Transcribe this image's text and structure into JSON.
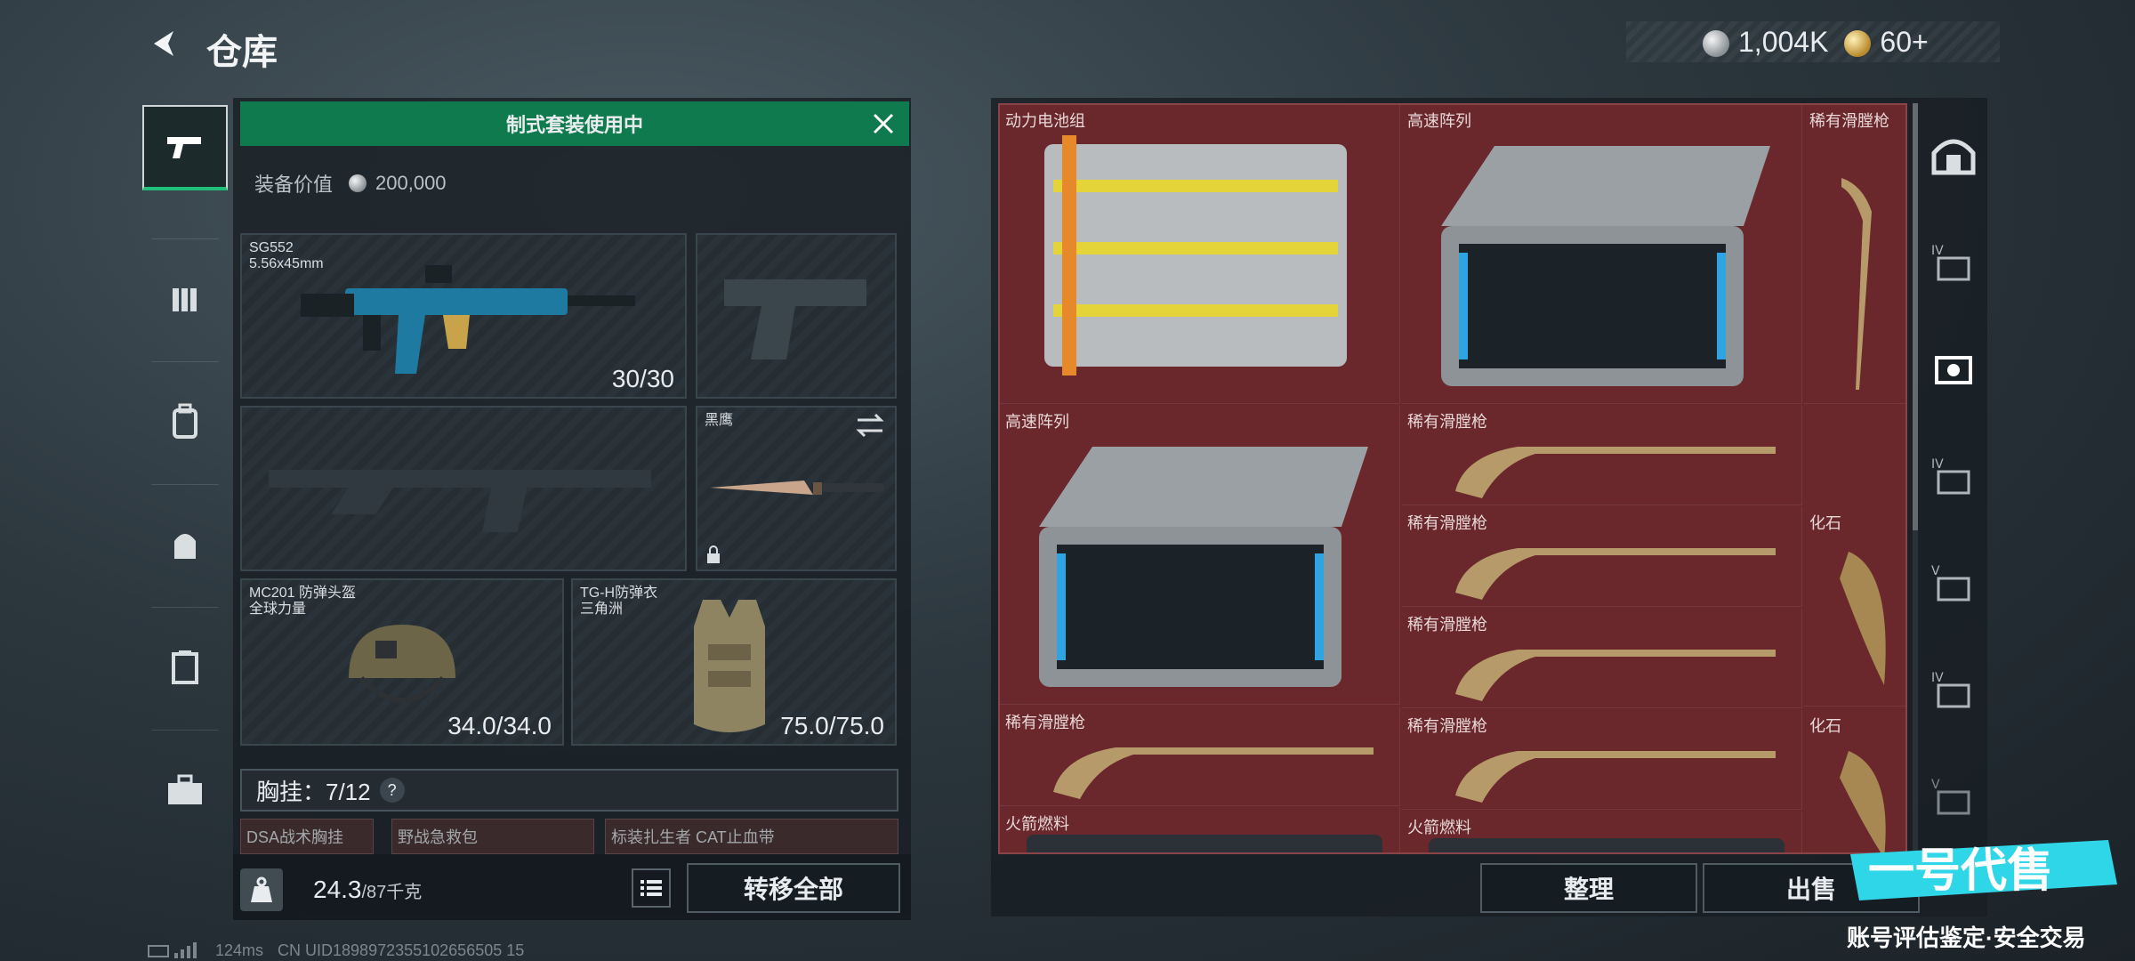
{
  "header": {
    "title": "仓库"
  },
  "currency": {
    "coins": "1,004K",
    "gold": "60+"
  },
  "banner": {
    "text": "制式套装使用中"
  },
  "loadout": {
    "value_label": "装备价值",
    "value": "200,000",
    "primary": {
      "name": "SG552",
      "caliber": "5.56x45mm",
      "ammo": "30/30"
    },
    "melee": {
      "name": "黑鹰"
    },
    "helmet": {
      "name": "MC201 防弹头盔",
      "brand": "全球力量",
      "durability": "34.0/34.0"
    },
    "armor": {
      "name": "TG-H防弹衣",
      "brand": "三角洲",
      "durability": "75.0/75.0"
    },
    "chest": {
      "label": "胸挂：7/12",
      "help": "?"
    },
    "subslots": [
      "DSA战术胸挂",
      "野战急救包",
      "标装扎生者 CAT止血带"
    ],
    "weight": {
      "current": "24.3",
      "max": "/87千克"
    },
    "transfer_label": "转移全部"
  },
  "storage": {
    "items": [
      {
        "label": "动力电池组"
      },
      {
        "label": "高速阵列"
      },
      {
        "label": "稀有滑膛枪"
      },
      {
        "label": "高速阵列"
      },
      {
        "label": "稀有滑膛枪"
      },
      {
        "label": "稀有滑膛枪"
      },
      {
        "label": "化石"
      },
      {
        "label": "稀有滑膛枪"
      },
      {
        "label": "稀有滑膛枪"
      },
      {
        "label": "稀有滑膛枪"
      },
      {
        "label": "化石"
      },
      {
        "label": "火箭燃料"
      },
      {
        "label": "火箭燃料"
      }
    ],
    "sort_label": "整理",
    "sell_label": "出售"
  },
  "status": {
    "ping": "124ms",
    "uid": "CN UID1898972355102656505 15"
  },
  "watermark": {
    "logo": "一号代售",
    "tagline": "账号评估鉴定·安全交易"
  },
  "colors": {
    "accent": "#0f7a4e",
    "storage_bg": "#6a282c"
  }
}
